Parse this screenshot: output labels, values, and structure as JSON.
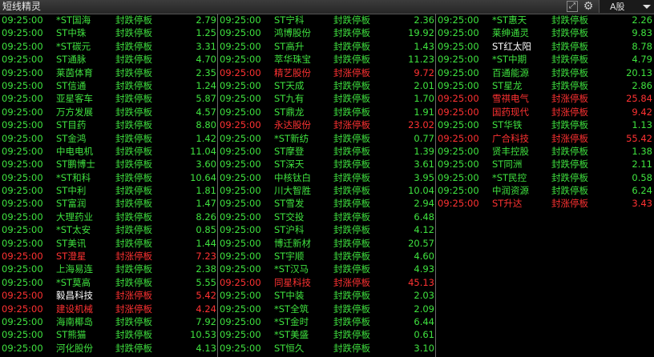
{
  "window": {
    "title": "短线精灵"
  },
  "toolbar": {
    "expand_icon": "expand-icon",
    "gear_icon": "gear-icon",
    "market_selected": "A股"
  },
  "colors": {
    "limit_down": "#3fe23f",
    "limit_up": "#ff3232",
    "background": "#000000"
  },
  "columns": [
    [
      {
        "time": "09:25:00",
        "name": "*ST国海",
        "status": "封跌停板",
        "value": "2.79",
        "dir": "down"
      },
      {
        "time": "09:25:00",
        "name": "ST中珠",
        "status": "封跌停板",
        "value": "1.25",
        "dir": "down"
      },
      {
        "time": "09:25:00",
        "name": "*ST碳元",
        "status": "封跌停板",
        "value": "3.31",
        "dir": "down"
      },
      {
        "time": "09:25:00",
        "name": "ST通脉",
        "status": "封跌停板",
        "value": "4.70",
        "dir": "down"
      },
      {
        "time": "09:25:00",
        "name": "莱茵体育",
        "status": "封跌停板",
        "value": "2.35",
        "dir": "down"
      },
      {
        "time": "09:25:00",
        "name": "ST信通",
        "status": "封跌停板",
        "value": "1.24",
        "dir": "down"
      },
      {
        "time": "09:25:00",
        "name": "亚星客车",
        "status": "封跌停板",
        "value": "5.87",
        "dir": "down"
      },
      {
        "time": "09:25:00",
        "name": "万方发展",
        "status": "封跌停板",
        "value": "4.57",
        "dir": "down"
      },
      {
        "time": "09:25:00",
        "name": "ST目药",
        "status": "封跌停板",
        "value": "8.80",
        "dir": "down"
      },
      {
        "time": "09:25:00",
        "name": "ST金鸿",
        "status": "封跌停板",
        "value": "1.42",
        "dir": "down"
      },
      {
        "time": "09:25:00",
        "name": "中电电机",
        "status": "封跌停板",
        "value": "11.04",
        "dir": "down"
      },
      {
        "time": "09:25:00",
        "name": "ST鹏博士",
        "status": "封跌停板",
        "value": "3.60",
        "dir": "down"
      },
      {
        "time": "09:25:00",
        "name": "*ST和科",
        "status": "封跌停板",
        "value": "10.64",
        "dir": "down"
      },
      {
        "time": "09:25:00",
        "name": "ST中利",
        "status": "封跌停板",
        "value": "1.81",
        "dir": "down"
      },
      {
        "time": "09:25:00",
        "name": "ST富润",
        "status": "封跌停板",
        "value": "1.47",
        "dir": "down"
      },
      {
        "time": "09:25:00",
        "name": "大理药业",
        "status": "封跌停板",
        "value": "8.26",
        "dir": "down"
      },
      {
        "time": "09:25:00",
        "name": "*ST太安",
        "status": "封跌停板",
        "value": "0.85",
        "dir": "down"
      },
      {
        "time": "09:25:00",
        "name": "ST美讯",
        "status": "封跌停板",
        "value": "1.44",
        "dir": "down"
      },
      {
        "time": "09:25:00",
        "name": "ST澄星",
        "status": "封涨停板",
        "value": "7.23",
        "dir": "up"
      },
      {
        "time": "09:25:00",
        "name": "上海易连",
        "status": "封跌停板",
        "value": "2.38",
        "dir": "down"
      },
      {
        "time": "09:25:00",
        "name": "*ST莫高",
        "status": "封跌停板",
        "value": "5.55",
        "dir": "down"
      },
      {
        "time": "09:25:00",
        "name": "毅昌科技",
        "status": "封涨停板",
        "value": "5.42",
        "dir": "up"
      },
      {
        "time": "09:25:00",
        "name": "建设机械",
        "status": "封涨停板",
        "value": "4.24",
        "dir": "up"
      },
      {
        "time": "09:25:00",
        "name": "海南椰岛",
        "status": "封跌停板",
        "value": "7.92",
        "dir": "down"
      },
      {
        "time": "09:25:00",
        "name": "ST熊猫",
        "status": "封跌停板",
        "value": "10.53",
        "dir": "down"
      },
      {
        "time": "09:25:00",
        "name": "河化股份",
        "status": "封跌停板",
        "value": "4.13",
        "dir": "down"
      }
    ],
    [
      {
        "time": "09:25:00",
        "name": "ST宁科",
        "status": "封跌停板",
        "value": "2.36",
        "dir": "down"
      },
      {
        "time": "09:25:00",
        "name": "鸿博股份",
        "status": "封跌停板",
        "value": "19.92",
        "dir": "down"
      },
      {
        "time": "09:25:00",
        "name": "ST高升",
        "status": "封跌停板",
        "value": "1.43",
        "dir": "down"
      },
      {
        "time": "09:25:00",
        "name": "萃华珠宝",
        "status": "封跌停板",
        "value": "11.23",
        "dir": "down"
      },
      {
        "time": "09:25:00",
        "name": "精艺股份",
        "status": "封涨停板",
        "value": "9.72",
        "dir": "up"
      },
      {
        "time": "09:25:00",
        "name": "ST天成",
        "status": "封跌停板",
        "value": "2.01",
        "dir": "down"
      },
      {
        "time": "09:25:00",
        "name": "ST九有",
        "status": "封跌停板",
        "value": "1.70",
        "dir": "down"
      },
      {
        "time": "09:25:00",
        "name": "ST鼎龙",
        "status": "封跌停板",
        "value": "1.91",
        "dir": "down"
      },
      {
        "time": "09:25:00",
        "name": "永达股份",
        "status": "封涨停板",
        "value": "23.02",
        "dir": "up"
      },
      {
        "time": "09:25:00",
        "name": "*ST新纺",
        "status": "封跌停板",
        "value": "0.77",
        "dir": "down"
      },
      {
        "time": "09:25:00",
        "name": "ST摩登",
        "status": "封跌停板",
        "value": "1.39",
        "dir": "down"
      },
      {
        "time": "09:25:00",
        "name": "ST深天",
        "status": "封跌停板",
        "value": "3.61",
        "dir": "down"
      },
      {
        "time": "09:25:00",
        "name": "中核钛白",
        "status": "封跌停板",
        "value": "3.95",
        "dir": "down"
      },
      {
        "time": "09:25:00",
        "name": "川大智胜",
        "status": "封跌停板",
        "value": "10.04",
        "dir": "down"
      },
      {
        "time": "09:25:00",
        "name": "ST雪发",
        "status": "封跌停板",
        "value": "2.94",
        "dir": "down"
      },
      {
        "time": "09:25:00",
        "name": "ST交投",
        "status": "封跌停板",
        "value": "6.48",
        "dir": "down"
      },
      {
        "time": "09:25:00",
        "name": "ST沪科",
        "status": "封跌停板",
        "value": "4.12",
        "dir": "down"
      },
      {
        "time": "09:25:00",
        "name": "博迁新材",
        "status": "封跌停板",
        "value": "20.57",
        "dir": "down"
      },
      {
        "time": "09:25:00",
        "name": "ST宇顺",
        "status": "封跌停板",
        "value": "4.60",
        "dir": "down"
      },
      {
        "time": "09:25:00",
        "name": "*ST汉马",
        "status": "封跌停板",
        "value": "4.93",
        "dir": "down"
      },
      {
        "time": "09:25:00",
        "name": "同星科技",
        "status": "封涨停板",
        "value": "45.13",
        "dir": "up"
      },
      {
        "time": "09:25:00",
        "name": "ST中装",
        "status": "封跌停板",
        "value": "2.03",
        "dir": "down"
      },
      {
        "time": "09:25:00",
        "name": "*ST全筑",
        "status": "封跌停板",
        "value": "2.09",
        "dir": "down"
      },
      {
        "time": "09:25:00",
        "name": "*ST金时",
        "status": "封跌停板",
        "value": "6.44",
        "dir": "down"
      },
      {
        "time": "09:25:00",
        "name": "*ST美盛",
        "status": "封跌停板",
        "value": "0.61",
        "dir": "down"
      },
      {
        "time": "09:25:00",
        "name": "ST恒久",
        "status": "封跌停板",
        "value": "3.10",
        "dir": "down"
      }
    ],
    [
      {
        "time": "09:25:00",
        "name": "*ST惠天",
        "status": "封跌停板",
        "value": "2.26",
        "dir": "down"
      },
      {
        "time": "09:25:00",
        "name": "莱绅通灵",
        "status": "封跌停板",
        "value": "9.83",
        "dir": "down"
      },
      {
        "time": "09:25:00",
        "name": "ST红太阳",
        "status": "封跌停板",
        "value": "8.78",
        "dir": "down"
      },
      {
        "time": "09:25:00",
        "name": "*ST中期",
        "status": "封跌停板",
        "value": "4.79",
        "dir": "down"
      },
      {
        "time": "09:25:00",
        "name": "百通能源",
        "status": "封跌停板",
        "value": "20.13",
        "dir": "down"
      },
      {
        "time": "09:25:00",
        "name": "ST星龙",
        "status": "封跌停板",
        "value": "2.86",
        "dir": "down"
      },
      {
        "time": "09:25:00",
        "name": "雪祺电气",
        "status": "封涨停板",
        "value": "25.84",
        "dir": "up"
      },
      {
        "time": "09:25:00",
        "name": "国药现代",
        "status": "封涨停板",
        "value": "9.42",
        "dir": "up"
      },
      {
        "time": "09:25:00",
        "name": "ST华铁",
        "status": "封跌停板",
        "value": "1.13",
        "dir": "down"
      },
      {
        "time": "09:25:00",
        "name": "广合科技",
        "status": "封涨停板",
        "value": "55.42",
        "dir": "up"
      },
      {
        "time": "09:25:00",
        "name": "贤丰控股",
        "status": "封跌停板",
        "value": "1.38",
        "dir": "down"
      },
      {
        "time": "09:25:00",
        "name": "ST同洲",
        "status": "封跌停板",
        "value": "2.11",
        "dir": "down"
      },
      {
        "time": "09:25:00",
        "name": "*ST民控",
        "status": "封跌停板",
        "value": "0.58",
        "dir": "down"
      },
      {
        "time": "09:25:00",
        "name": "中润资源",
        "status": "封跌停板",
        "value": "6.24",
        "dir": "down"
      },
      {
        "time": "09:25:00",
        "name": "ST升达",
        "status": "封涨停板",
        "value": "3.43",
        "dir": "up"
      }
    ]
  ]
}
